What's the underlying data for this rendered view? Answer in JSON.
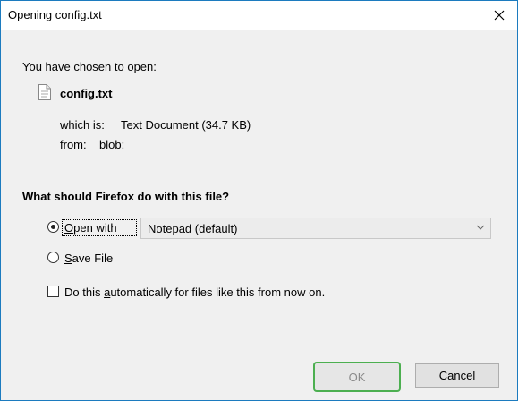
{
  "window": {
    "title": "Opening config.txt"
  },
  "intro": "You have chosen to open:",
  "file": {
    "name": "config.txt",
    "which_is_label": "which is:",
    "which_is_value": "Text Document (34.7 KB)",
    "from_label": "from:",
    "from_value": "blob:"
  },
  "question": "What should Firefox do with this file?",
  "options": {
    "open_with": {
      "prefix": "O",
      "rest": "pen with",
      "checked": true
    },
    "app_select": {
      "value": "Notepad (default)"
    },
    "save_file": {
      "prefix": "S",
      "rest": "ave File",
      "checked": false
    }
  },
  "auto": {
    "pre": "Do this ",
    "accel": "a",
    "post": "utomatically for files like this from now on.",
    "checked": false
  },
  "buttons": {
    "ok": "OK",
    "cancel": "Cancel"
  },
  "icons": {
    "close": "close-icon",
    "file": "text-file-icon",
    "dropdown": "chevron-down-icon"
  },
  "colors": {
    "ok_focus_border": "#4caf50",
    "window_border": "#1c7bbf"
  }
}
